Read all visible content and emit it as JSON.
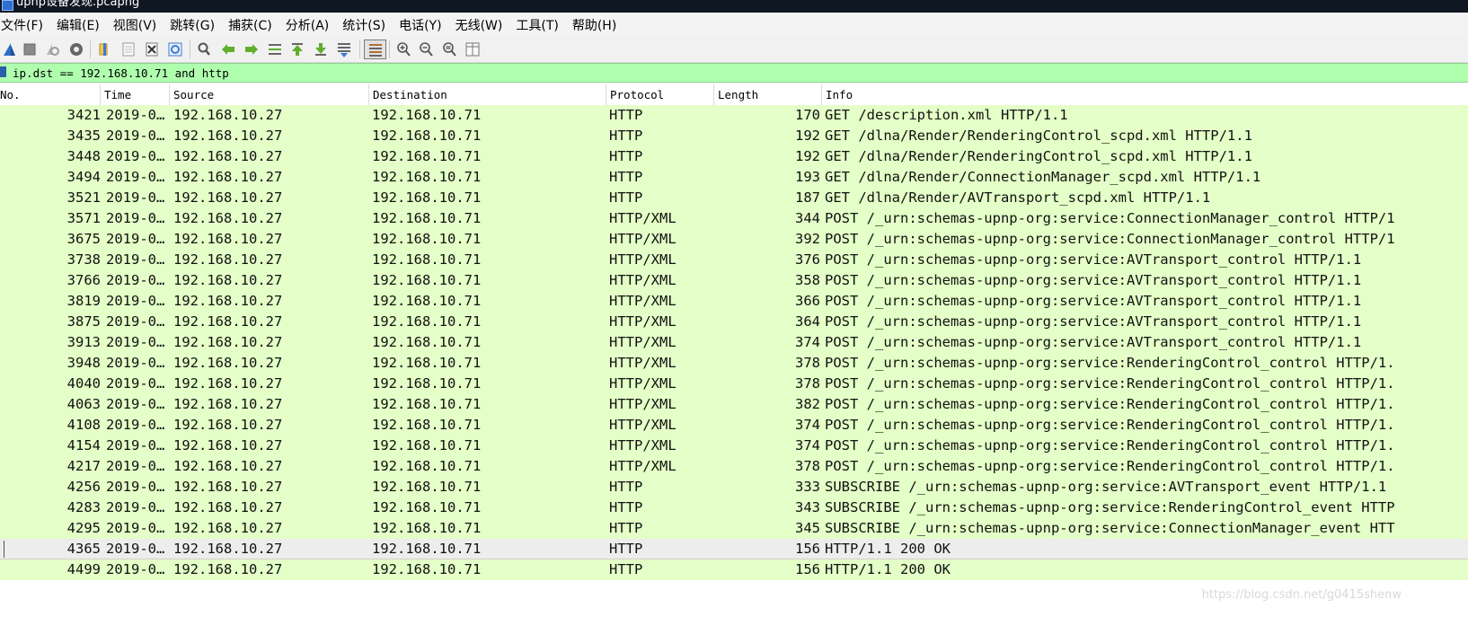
{
  "window": {
    "title": "upnp设备发现.pcapng"
  },
  "menu": [
    "文件(F)",
    "编辑(E)",
    "视图(V)",
    "跳转(G)",
    "捕获(C)",
    "分析(A)",
    "统计(S)",
    "电话(Y)",
    "无线(W)",
    "工具(T)",
    "帮助(H)"
  ],
  "filter": {
    "value": "ip.dst == 192.168.10.71 and http"
  },
  "columns": [
    "No.",
    "Time",
    "Source",
    "Destination",
    "Protocol",
    "Length",
    "Info"
  ],
  "packets": [
    {
      "no": "3421",
      "time": "2019-0…",
      "src": "192.168.10.27",
      "dst": "192.168.10.71",
      "proto": "HTTP",
      "len": "170",
      "info": "GET /description.xml HTTP/1.1"
    },
    {
      "no": "3435",
      "time": "2019-0…",
      "src": "192.168.10.27",
      "dst": "192.168.10.71",
      "proto": "HTTP",
      "len": "192",
      "info": "GET /dlna/Render/RenderingControl_scpd.xml HTTP/1.1"
    },
    {
      "no": "3448",
      "time": "2019-0…",
      "src": "192.168.10.27",
      "dst": "192.168.10.71",
      "proto": "HTTP",
      "len": "192",
      "info": "GET /dlna/Render/RenderingControl_scpd.xml HTTP/1.1"
    },
    {
      "no": "3494",
      "time": "2019-0…",
      "src": "192.168.10.27",
      "dst": "192.168.10.71",
      "proto": "HTTP",
      "len": "193",
      "info": "GET /dlna/Render/ConnectionManager_scpd.xml HTTP/1.1"
    },
    {
      "no": "3521",
      "time": "2019-0…",
      "src": "192.168.10.27",
      "dst": "192.168.10.71",
      "proto": "HTTP",
      "len": "187",
      "info": "GET /dlna/Render/AVTransport_scpd.xml HTTP/1.1"
    },
    {
      "no": "3571",
      "time": "2019-0…",
      "src": "192.168.10.27",
      "dst": "192.168.10.71",
      "proto": "HTTP/XML",
      "len": "344",
      "info": "POST /_urn:schemas-upnp-org:service:ConnectionManager_control HTTP/1"
    },
    {
      "no": "3675",
      "time": "2019-0…",
      "src": "192.168.10.27",
      "dst": "192.168.10.71",
      "proto": "HTTP/XML",
      "len": "392",
      "info": "POST /_urn:schemas-upnp-org:service:ConnectionManager_control HTTP/1"
    },
    {
      "no": "3738",
      "time": "2019-0…",
      "src": "192.168.10.27",
      "dst": "192.168.10.71",
      "proto": "HTTP/XML",
      "len": "376",
      "info": "POST /_urn:schemas-upnp-org:service:AVTransport_control HTTP/1.1"
    },
    {
      "no": "3766",
      "time": "2019-0…",
      "src": "192.168.10.27",
      "dst": "192.168.10.71",
      "proto": "HTTP/XML",
      "len": "358",
      "info": "POST /_urn:schemas-upnp-org:service:AVTransport_control HTTP/1.1"
    },
    {
      "no": "3819",
      "time": "2019-0…",
      "src": "192.168.10.27",
      "dst": "192.168.10.71",
      "proto": "HTTP/XML",
      "len": "366",
      "info": "POST /_urn:schemas-upnp-org:service:AVTransport_control HTTP/1.1"
    },
    {
      "no": "3875",
      "time": "2019-0…",
      "src": "192.168.10.27",
      "dst": "192.168.10.71",
      "proto": "HTTP/XML",
      "len": "364",
      "info": "POST /_urn:schemas-upnp-org:service:AVTransport_control HTTP/1.1"
    },
    {
      "no": "3913",
      "time": "2019-0…",
      "src": "192.168.10.27",
      "dst": "192.168.10.71",
      "proto": "HTTP/XML",
      "len": "374",
      "info": "POST /_urn:schemas-upnp-org:service:AVTransport_control HTTP/1.1"
    },
    {
      "no": "3948",
      "time": "2019-0…",
      "src": "192.168.10.27",
      "dst": "192.168.10.71",
      "proto": "HTTP/XML",
      "len": "378",
      "info": "POST /_urn:schemas-upnp-org:service:RenderingControl_control HTTP/1."
    },
    {
      "no": "4040",
      "time": "2019-0…",
      "src": "192.168.10.27",
      "dst": "192.168.10.71",
      "proto": "HTTP/XML",
      "len": "378",
      "info": "POST /_urn:schemas-upnp-org:service:RenderingControl_control HTTP/1."
    },
    {
      "no": "4063",
      "time": "2019-0…",
      "src": "192.168.10.27",
      "dst": "192.168.10.71",
      "proto": "HTTP/XML",
      "len": "382",
      "info": "POST /_urn:schemas-upnp-org:service:RenderingControl_control HTTP/1."
    },
    {
      "no": "4108",
      "time": "2019-0…",
      "src": "192.168.10.27",
      "dst": "192.168.10.71",
      "proto": "HTTP/XML",
      "len": "374",
      "info": "POST /_urn:schemas-upnp-org:service:RenderingControl_control HTTP/1."
    },
    {
      "no": "4154",
      "time": "2019-0…",
      "src": "192.168.10.27",
      "dst": "192.168.10.71",
      "proto": "HTTP/XML",
      "len": "374",
      "info": "POST /_urn:schemas-upnp-org:service:RenderingControl_control HTTP/1."
    },
    {
      "no": "4217",
      "time": "2019-0…",
      "src": "192.168.10.27",
      "dst": "192.168.10.71",
      "proto": "HTTP/XML",
      "len": "378",
      "info": "POST /_urn:schemas-upnp-org:service:RenderingControl_control HTTP/1."
    },
    {
      "no": "4256",
      "time": "2019-0…",
      "src": "192.168.10.27",
      "dst": "192.168.10.71",
      "proto": "HTTP",
      "len": "333",
      "info": "SUBSCRIBE /_urn:schemas-upnp-org:service:AVTransport_event HTTP/1.1"
    },
    {
      "no": "4283",
      "time": "2019-0…",
      "src": "192.168.10.27",
      "dst": "192.168.10.71",
      "proto": "HTTP",
      "len": "343",
      "info": "SUBSCRIBE /_urn:schemas-upnp-org:service:RenderingControl_event HTTP"
    },
    {
      "no": "4295",
      "time": "2019-0…",
      "src": "192.168.10.27",
      "dst": "192.168.10.71",
      "proto": "HTTP",
      "len": "345",
      "info": "SUBSCRIBE /_urn:schemas-upnp-org:service:ConnectionManager_event HTT"
    },
    {
      "no": "4365",
      "time": "2019-0…",
      "src": "192.168.10.27",
      "dst": "192.168.10.71",
      "proto": "HTTP",
      "len": "156",
      "info": "HTTP/1.1 200 OK",
      "selected": true
    },
    {
      "no": "4499",
      "time": "2019-0…",
      "src": "192.168.10.27",
      "dst": "192.168.10.71",
      "proto": "HTTP",
      "len": "156",
      "info": "HTTP/1.1 200 OK"
    }
  ],
  "watermark": "https://blog.csdn.net/g0415shenw",
  "colors": {
    "row_bg": "#e4ffc7",
    "selected_row_bg": "#ededed",
    "filter_bg": "#afffaf"
  },
  "toolbar_icons": [
    "shark-fin-start-icon",
    "stop-icon",
    "restart-icon",
    "options-icon",
    "open-file-icon",
    "save-file-icon",
    "close-file-icon",
    "reload-icon",
    "find-icon",
    "back-arrow-icon",
    "forward-arrow-icon",
    "go-to-packet-icon",
    "first-packet-icon",
    "last-packet-icon",
    "autoscroll-icon",
    "colorize-icon",
    "zoom-in-icon",
    "zoom-out-icon",
    "normal-size-icon",
    "resize-columns-icon"
  ]
}
